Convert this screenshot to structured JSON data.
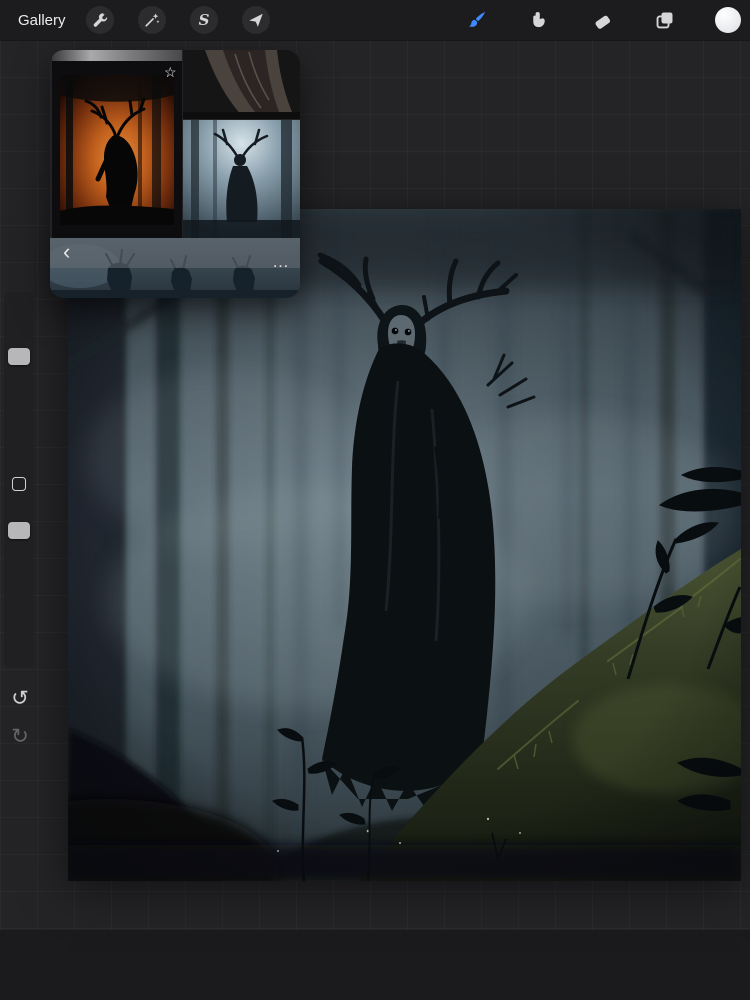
{
  "toolbar": {
    "gallery_label": "Gallery",
    "left_tools": [
      {
        "name": "actions",
        "icon": "wrench-icon"
      },
      {
        "name": "adjustments",
        "icon": "magic-wand-icon"
      },
      {
        "name": "selection",
        "icon": "selection-s-icon",
        "glyph": "S"
      },
      {
        "name": "transform",
        "icon": "transform-arrow-icon"
      }
    ],
    "right_tools": [
      {
        "name": "paint",
        "icon": "paintbrush-icon",
        "active": true,
        "accent_color": "#3e8bff"
      },
      {
        "name": "smudge",
        "icon": "smudge-finger-icon",
        "active": false
      },
      {
        "name": "erase",
        "icon": "eraser-icon",
        "active": false
      },
      {
        "name": "layers",
        "icon": "layers-icon",
        "active": false
      },
      {
        "name": "color",
        "icon": "color-swatch-circle",
        "active": false,
        "swatch_color": "#edeff1"
      }
    ]
  },
  "sidebar": {
    "undo_glyph": "↺",
    "redo_glyph": "↻"
  },
  "reference_panel": {
    "back_glyph": "‹",
    "more_glyph": "…",
    "star_glyph": "☆",
    "thumbnails": [
      {
        "name": "gray-sliver-photo"
      },
      {
        "name": "fire-wendigo-photo",
        "starred": true
      },
      {
        "name": "dark-cloth-photo"
      },
      {
        "name": "antlered-figure-photo"
      },
      {
        "name": "creatures-strip-photo"
      }
    ]
  },
  "canvas": {
    "subject": "hooded antlered forest spirit standing in misty pine forest",
    "palette": {
      "fog": "#8a9ba4",
      "midtone": "#54646d",
      "shadow": "#0b1013",
      "moss_green": "#3c4429"
    }
  }
}
